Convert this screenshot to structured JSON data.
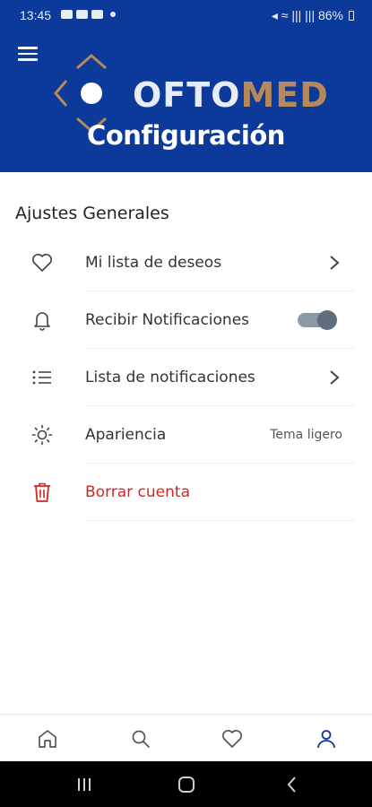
{
  "status_bar": {
    "time": "13:45",
    "signal_text": "◂ ≈ ||| ||| 86%"
  },
  "header": {
    "logo_text_a": "OFTO",
    "logo_text_b": "MED",
    "title": "Configuración",
    "colors": {
      "background": "#0c3a9a",
      "logo_accent": "#b6895a"
    }
  },
  "section": {
    "title": "Ajustes Generales"
  },
  "settings": [
    {
      "label": "Mi lista de deseos",
      "icon": "heart-icon",
      "trailing": "chevron"
    },
    {
      "label": "Recibir Notificaciones",
      "icon": "bell-icon",
      "trailing": "toggle",
      "enabled": true
    },
    {
      "label": "Lista de notificaciones",
      "icon": "list-icon",
      "trailing": "chevron"
    },
    {
      "label": "Apariencia",
      "icon": "sun-icon",
      "trailing": "value",
      "value": "Tema ligero"
    },
    {
      "label": "Borrar cuenta",
      "icon": "trash-icon",
      "trailing": "none",
      "color": "#d42424"
    }
  ],
  "bottom_nav": [
    {
      "name": "home",
      "icon": "home-icon"
    },
    {
      "name": "search",
      "icon": "search-icon"
    },
    {
      "name": "favorites",
      "icon": "heart-icon"
    },
    {
      "name": "profile",
      "icon": "user-icon",
      "active": true,
      "active_color": "#0c3a9a"
    }
  ]
}
